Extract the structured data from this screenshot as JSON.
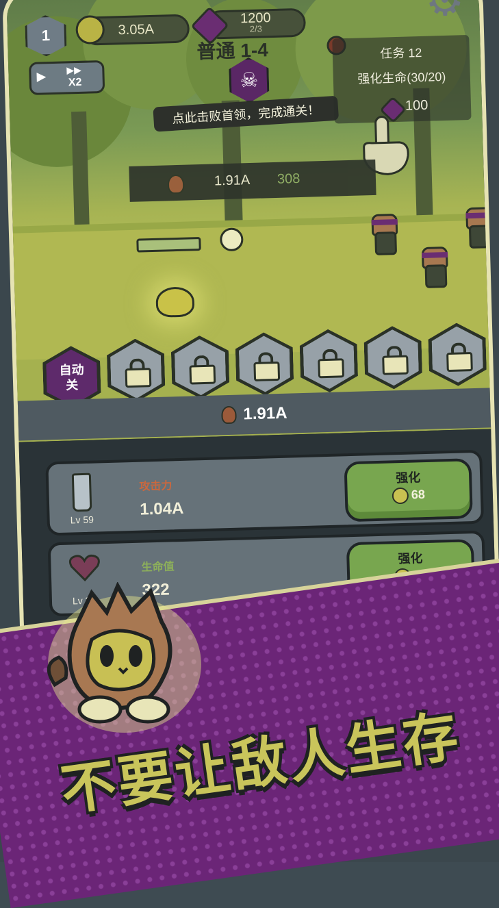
{
  "hud": {
    "player_level": "1",
    "gold": "3.05A",
    "gems": "1200",
    "gems_sub": "2/3",
    "stage_title": "普通 1-4",
    "speed": {
      "label": "X2"
    }
  },
  "boss": {
    "tip": "点此击败首领，完成通关！"
  },
  "task": {
    "title": "任务 12",
    "desc": "强化生命(30/20)",
    "reward": "100"
  },
  "enemy_bar": {
    "value": "1.91A",
    "count": "308"
  },
  "skills": {
    "auto": {
      "line1": "自动",
      "line2": "关"
    },
    "locked_count": 6
  },
  "dps": {
    "value": "1.91A"
  },
  "upgrades": [
    {
      "name": "攻击力",
      "level": "Lv 59",
      "value": "1.04A",
      "button": "强化",
      "cost": "68",
      "name_color": "#b9593b"
    },
    {
      "name": "生命值",
      "level": "Lv 30",
      "value": "322",
      "button": "强化",
      "cost": "21",
      "name_color": "#7ea34e"
    },
    {
      "name": "",
      "level": "",
      "value": "",
      "button": "强化",
      "cost": "",
      "name_color": "#7ea34e"
    }
  ],
  "banner": {
    "slogan": "不要让敌人生存"
  },
  "colors": {
    "accent_purple": "#6b2577",
    "upgrade_green": "#78a64f",
    "panel": "#2a3337"
  }
}
